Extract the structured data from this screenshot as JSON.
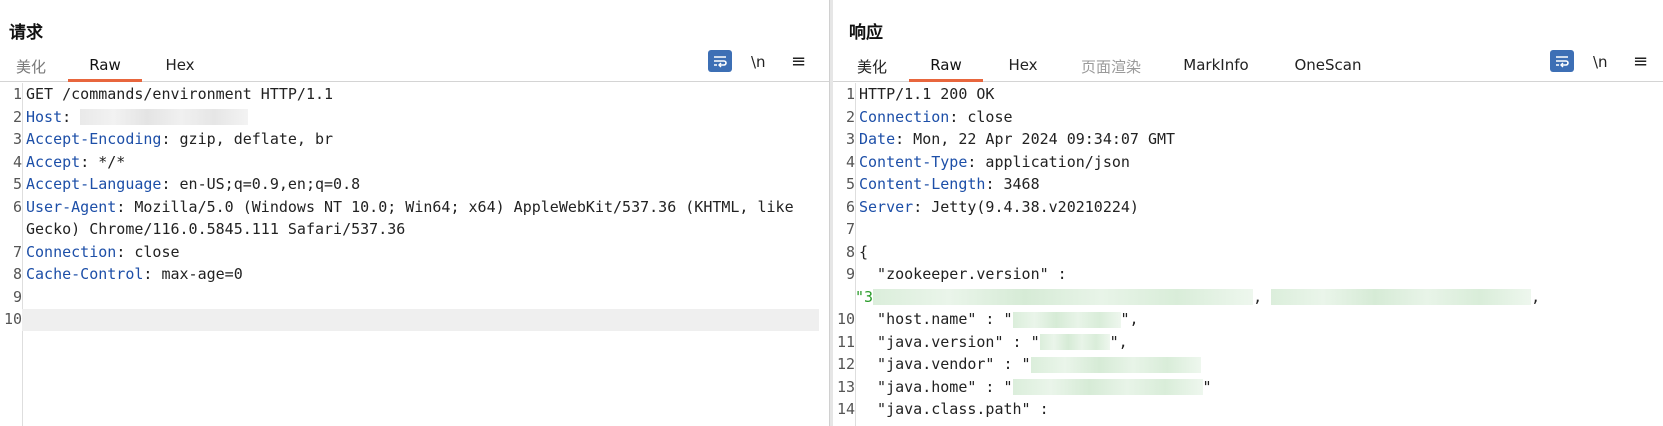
{
  "request": {
    "title": "请求",
    "tabs": [
      "美化",
      "Raw",
      "Hex"
    ],
    "active_tab": "Raw",
    "tools": {
      "newline": "\\n",
      "menu": "≡"
    },
    "lines": [
      {
        "n": "1",
        "key": "",
        "sep": "",
        "val": "GET /commands/environment HTTP/1.1"
      },
      {
        "n": "2",
        "key": "Host",
        "sep": ":",
        "val": ""
      },
      {
        "n": "3",
        "key": "Accept-Encoding",
        "sep": ":",
        "val": " gzip, deflate, br"
      },
      {
        "n": "4",
        "key": "Accept",
        "sep": ":",
        "val": " */*"
      },
      {
        "n": "5",
        "key": "Accept-Language",
        "sep": ":",
        "val": " en-US;q=0.9,en;q=0.8"
      },
      {
        "n": "6",
        "key": "User-Agent",
        "sep": ":",
        "val": " Mozilla/5.0 (Windows NT 10.0; Win64; x64) AppleWebKit/537.36 (KHTML, like"
      },
      {
        "n": "",
        "key": "",
        "sep": "",
        "val": "Gecko) Chrome/116.0.5845.111 Safari/537.36"
      },
      {
        "n": "7",
        "key": "Connection",
        "sep": ":",
        "val": " close"
      },
      {
        "n": "8",
        "key": "Cache-Control",
        "sep": ":",
        "val": " max-age=0"
      },
      {
        "n": "9",
        "key": "",
        "sep": "",
        "val": ""
      },
      {
        "n": "10",
        "key": "",
        "sep": "",
        "val": ""
      }
    ]
  },
  "response": {
    "title": "响应",
    "tabs": [
      "美化",
      "Raw",
      "Hex",
      "页面渲染",
      "MarkInfo",
      "OneScan"
    ],
    "active_tab": "Raw",
    "tools": {
      "newline": "\\n",
      "menu": "≡"
    },
    "lines": [
      {
        "n": "1",
        "key": "",
        "sep": "",
        "val": "HTTP/1.1 200 OK"
      },
      {
        "n": "2",
        "key": "Connection",
        "sep": ":",
        "val": " close"
      },
      {
        "n": "3",
        "key": "Date",
        "sep": ":",
        "val": " Mon, 22 Apr 2024 09:34:07 GMT"
      },
      {
        "n": "4",
        "key": "Content-Type",
        "sep": ":",
        "val": " application/json"
      },
      {
        "n": "5",
        "key": "Content-Length",
        "sep": ":",
        "val": " 3468"
      },
      {
        "n": "6",
        "key": "Server",
        "sep": ":",
        "val": " Jetty(9.4.38.v20210224)"
      },
      {
        "n": "7",
        "key": "",
        "sep": "",
        "val": ""
      },
      {
        "n": "8",
        "key": "",
        "sep": "",
        "val": "{"
      },
      {
        "n": "9",
        "key": "",
        "sep": "",
        "val": "  \"zookeeper.version\" :"
      },
      {
        "n": "",
        "key": "",
        "sep": "",
        "val": "\"3"
      },
      {
        "n": "10",
        "key": "",
        "sep": "",
        "val": "  \"host.name\" : \""
      },
      {
        "n": "11",
        "key": "",
        "sep": "",
        "val": "  \"java.version\" : \""
      },
      {
        "n": "12",
        "key": "",
        "sep": "",
        "val": "  \"java.vendor\" : \""
      },
      {
        "n": "13",
        "key": "",
        "sep": "",
        "val": "  \"java.home\" : \""
      },
      {
        "n": "14",
        "key": "",
        "sep": "",
        "val": "  \"java.class.path\" :"
      }
    ]
  },
  "colors": {
    "accent": "#e8663d",
    "header_key": "#1d4fa8",
    "json_string": "#2a9b2a",
    "button_blue": "#3d6fb5"
  }
}
